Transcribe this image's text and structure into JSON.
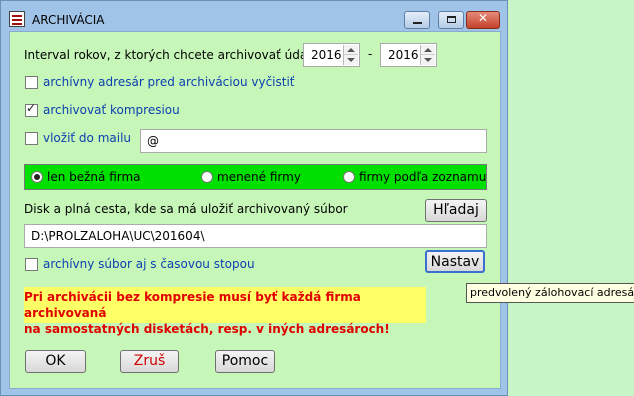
{
  "window": {
    "title": "ARCHIVÁCIA"
  },
  "interval": {
    "label": "Interval rokov, z ktorých chcete archivovať údaje",
    "from_year": "2016",
    "separator": "-",
    "to_year": "2016"
  },
  "options": {
    "clear_dir": {
      "label": "archívny adresár pred archiváciou vyčistiť",
      "checked": false
    },
    "compress": {
      "label": "archivovať kompresiou",
      "checked": true
    },
    "mail": {
      "label": "vložiť do mailu",
      "checked": false,
      "value": "@"
    }
  },
  "scope": {
    "options": [
      {
        "label": "len bežná firma",
        "selected": true
      },
      {
        "label": "menené firmy",
        "selected": false
      },
      {
        "label": "firmy podľa zoznamu",
        "selected": false
      }
    ]
  },
  "path": {
    "label": "Disk a plná cesta, kde sa má uložiť archivovaný súbor",
    "search_button": "Hľadaj",
    "value": "D:\\PROLZALOHA\\UC\\201604\\"
  },
  "timestamp": {
    "label": "archívny súbor aj s časovou stopou",
    "checked": false
  },
  "setup_button": "Nastav",
  "warning": {
    "line1": "Pri archivácii bez kompresie musí byť každá firma archivovaná",
    "line2": "na samostatných disketách, resp. v iných adresároch!"
  },
  "buttons": {
    "ok": "OK",
    "cancel": "Zruš",
    "help": "Pomoc"
  },
  "tooltip": "predvolený zálohovací adresár - ",
  "colors": {
    "desktop": "#c8f5c8",
    "client": "#c6f7b8",
    "radio_panel": "#00e000",
    "warning_bg": "#ffff66",
    "warning_text": "#e00000",
    "link_text": "#0c3fb0",
    "cancel_text": "#d00000"
  }
}
